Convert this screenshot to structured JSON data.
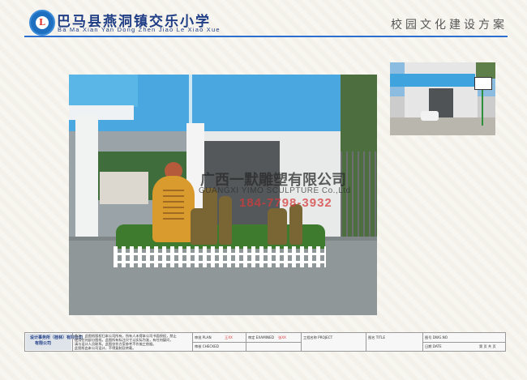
{
  "header": {
    "school_name_cn": "巴马县燕洞镇交乐小学",
    "school_name_pinyin": "Ba Ma Xian Yan Dong Zhen Jiao Le Xiao Xue",
    "plan_title": "校园文化建设方案",
    "rule_color": "#2a6fd0"
  },
  "main_photo": {
    "watermark_cn": "广西一默雕塑有限公司",
    "watermark_en": "GUANGXI YIMO SCULPTURE Co.,Ltd",
    "watermark_phone": "184-7798-3932"
  },
  "thumbnail": {
    "icon": "reference-photo"
  },
  "title_block": {
    "company": "设计事务所（桂林）有限公司",
    "company_line2": "有限公司",
    "notes": [
      "备注：此图纸版权归本公司所有，所有人未得本公司书面授权，禁止",
      "使用任何部分图纸。此图所有标注尺寸以实际为准，有任何疑问，",
      "请与设计人员联系。此图仅作方案参考不作施工依据。",
      "此图纸由本公司设计，不得复制及转载。"
    ],
    "plan_label": "审批 PLAN",
    "plan_value": "王XX",
    "design_label": "设计 DESIGN",
    "check_label": "审核 CHECKED",
    "examined_label": "审定 EXAMINED",
    "examined_value": "张XX",
    "project_label": "工程名称 PROJECT",
    "title_label": "图名 TITLE",
    "drawing_no_label": "图号 DWG.NO",
    "date_label": "日期 DATE",
    "sheet_label": "第 页 共 页"
  }
}
